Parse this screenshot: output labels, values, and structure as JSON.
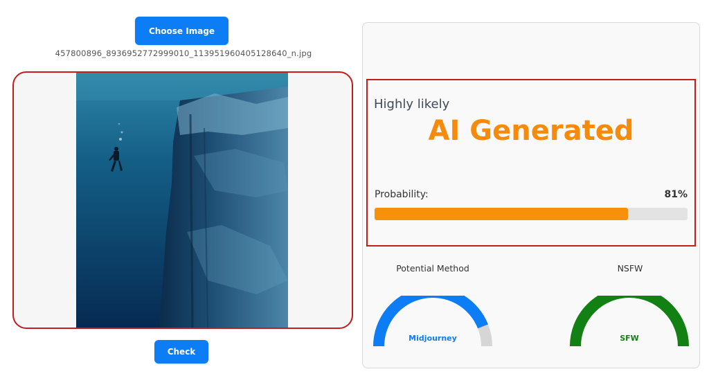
{
  "uploader": {
    "choose_label": "Choose Image",
    "filename": "457800896_893695277299901​0_113951960405128640_n.jpg",
    "check_label": "Check"
  },
  "result": {
    "verdict_prefix": "Highly likely",
    "verdict": "AI Generated",
    "probability_label": "Probability:",
    "probability_value": "81%",
    "probability_fraction": 0.81
  },
  "gauges": {
    "method": {
      "title": "Potential Method",
      "label": "Midjourney",
      "fraction": 0.88,
      "color": "#0d7df6"
    },
    "nsfw": {
      "title": "NSFW",
      "label": "SFW",
      "fraction": 1.0,
      "color": "#128012"
    }
  },
  "colors": {
    "primary": "#0d7df6",
    "accent_orange": "#f68a0b",
    "alert_red": "#c41c1c",
    "safe_green": "#128012"
  }
}
